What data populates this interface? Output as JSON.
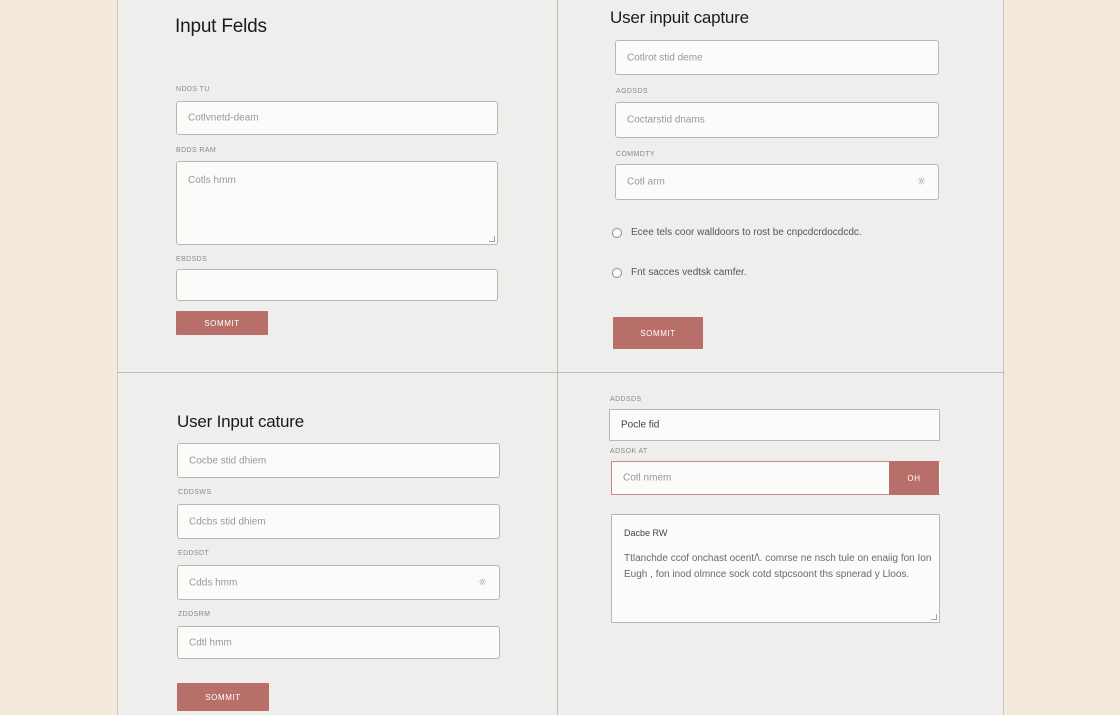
{
  "panels": {
    "top_left": {
      "title": "Input Felds",
      "fields": [
        {
          "label": "NDDS TU",
          "placeholder": "Cotlvnetd-deam"
        },
        {
          "label": "BDDS RAM",
          "placeholder": "Cotls hmm"
        },
        {
          "label": "EBDSDS",
          "placeholder": ""
        }
      ],
      "submit_label": "SOMMIT"
    },
    "top_right": {
      "title": "User inpuit capture",
      "fields": [
        {
          "label": "",
          "placeholder": "Cotlrot stid deme"
        },
        {
          "label": "AGDSDS",
          "placeholder": "Coctarstid dnams"
        },
        {
          "label": "COMMDTY",
          "placeholder": "Cotl arm",
          "icon": "eye-icon"
        }
      ],
      "radios": [
        "Ecee tels coor walldoors to rost be cnpcdcrdocdcdc.",
        "Fnt sacces vedtsk camfer."
      ],
      "submit_label": "SOMMIT"
    },
    "bottom_left": {
      "title": "User Input cature",
      "fields": [
        {
          "label": "",
          "placeholder": "Cocbe stid dhiem"
        },
        {
          "label": "CDDSWS",
          "placeholder": "Cdcbs stid dhiem"
        },
        {
          "label": "EDDSDT",
          "placeholder": "Cdds hmm",
          "icon": "eye-icon"
        },
        {
          "label": "ZDDSRM",
          "placeholder": "Cdtl hmm"
        }
      ],
      "submit_label": "SOMMIT"
    },
    "bottom_right": {
      "fields": [
        {
          "label": "ADDSDS",
          "value": "Pocle fid"
        },
        {
          "label": "ADSOK AT",
          "placeholder": "Cotl nmem",
          "button": "OH"
        }
      ],
      "notes": {
        "heading": "Dacbe RW",
        "body": "Ttlanchde ccof onchast ocent/\\. comrse ne nsch tule on enaiig fon Ion Eugh , fon inod olmnce sock cotd stpcsoont ths spnerad y Lloos."
      }
    }
  },
  "colors": {
    "background": "#f3eadb",
    "panel": "#efeeec",
    "accent": "#b86f6a",
    "border": "#b9b7b4"
  }
}
